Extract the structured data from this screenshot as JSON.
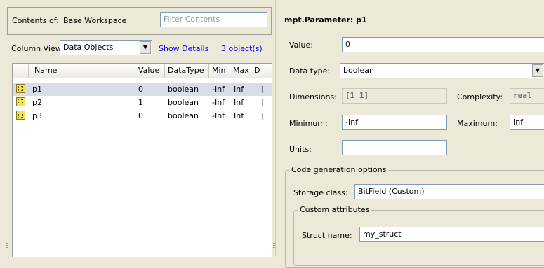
{
  "left": {
    "contents_label": "Contents of:",
    "workspace": "Base Workspace",
    "filter_placeholder": "Filter Contents",
    "column_view_label": "Column View:",
    "column_view_value": "Data Objects",
    "show_details": "Show Details",
    "object_count": "3 object(s)",
    "columns": [
      "Name",
      "Value",
      "DataType",
      "Min",
      "Max",
      "D"
    ],
    "rows": [
      {
        "name": "p1",
        "value": "0",
        "datatype": "boolean",
        "min": "-Inf",
        "max": "Inf",
        "d": "["
      },
      {
        "name": "p2",
        "value": "1",
        "datatype": "boolean",
        "min": "-Inf",
        "max": "Inf",
        "d": "["
      },
      {
        "name": "p3",
        "value": "0",
        "datatype": "boolean",
        "min": "-Inf",
        "max": "Inf",
        "d": "["
      }
    ],
    "selected_row": 0
  },
  "right": {
    "title": "mpt.Parameter: p1",
    "value_label": "Value:",
    "value": "0",
    "datatype_label": "Data type:",
    "datatype": "boolean",
    "dimensions_label": "Dimensions:",
    "dimensions": "[1 1]",
    "complexity_label": "Complexity:",
    "complexity": "real",
    "minimum_label": "Minimum:",
    "minimum": "-Inf",
    "maximum_label": "Maximum:",
    "maximum": "Inf",
    "units_label": "Units:",
    "units": "",
    "codegen_legend": "Code generation options",
    "storage_class_label": "Storage class:",
    "storage_class": "BitField (Custom)",
    "custom_attr_legend": "Custom attributes",
    "struct_name_label": "Struct name:",
    "struct_name": "my_struct"
  }
}
